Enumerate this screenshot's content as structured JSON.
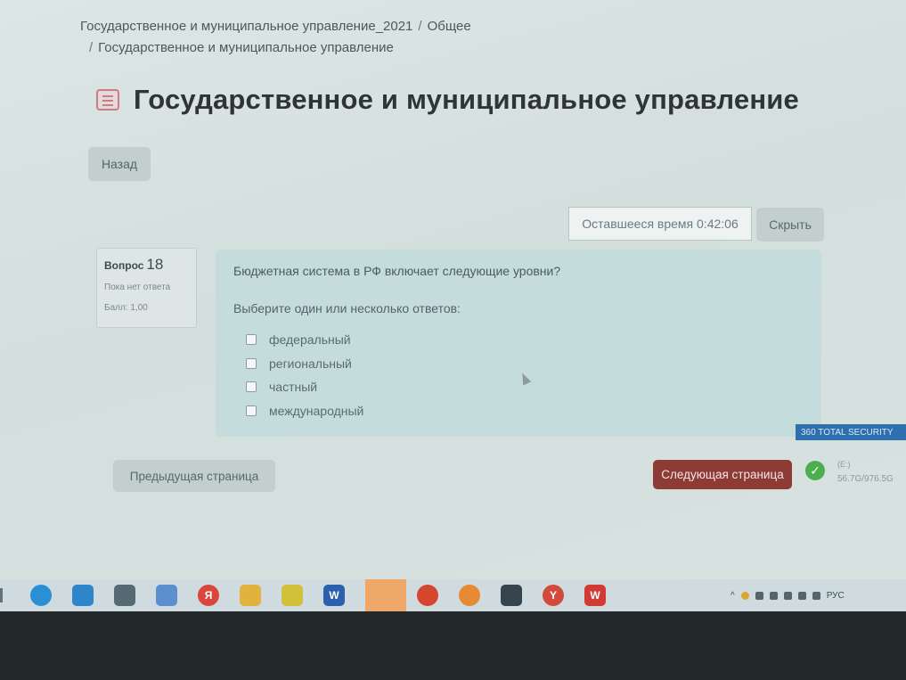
{
  "breadcrumb": {
    "course": "Государственное и муниципальное управление_2021",
    "section": "Общее",
    "page": "Государственное и муниципальное управление",
    "separator": "/"
  },
  "page_title": "Государственное и муниципальное управление",
  "back_button": "Назад",
  "timer": {
    "label": "Оставшееся время 0:42:06"
  },
  "hide_button": "Скрыть",
  "question_info": {
    "label": "Вопрос",
    "number": "18",
    "status": "Пока нет ответа",
    "score": "Балл: 1,00"
  },
  "question": {
    "text": "Бюджетная система в РФ включает следующие уровни?",
    "prompt": "Выберите один или несколько ответов:",
    "options": [
      {
        "label": "федеральный",
        "checked": false
      },
      {
        "label": "региональный",
        "checked": false
      },
      {
        "label": "частный",
        "checked": false
      },
      {
        "label": "международный",
        "checked": false
      }
    ]
  },
  "navigation": {
    "prev": "Предыдущая страница",
    "next": "Следующая страница"
  },
  "security_widget": {
    "badge": "360 TOTAL SECURITY",
    "drive": "(E:)",
    "usage": "56.7G/976.5G"
  },
  "taskbar": {
    "icons": [
      "task-view-icon",
      "edge-icon",
      "store-icon",
      "calculator-icon",
      "photos-icon",
      "yandex-icon",
      "file-explorer-icon",
      "app-icon",
      "word-icon",
      "active-app-icon",
      "chrome-icon",
      "chromium-icon",
      "camera-icon",
      "yandex-browser-icon",
      "wps-icon"
    ],
    "language": "РУС"
  },
  "colors": {
    "next_button": "#8f3b35",
    "question_card": "#c4dcdc",
    "security_badge": "#2e6fae"
  }
}
